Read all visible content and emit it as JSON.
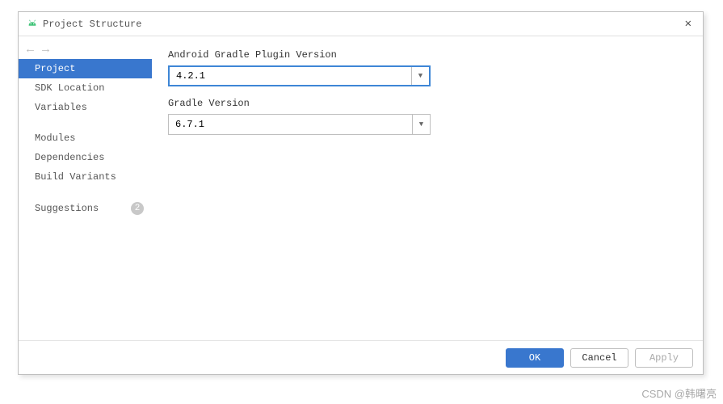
{
  "window": {
    "title": "Project Structure"
  },
  "sidebar": {
    "groups": [
      {
        "items": [
          {
            "label": "Project",
            "selected": true
          },
          {
            "label": "SDK Location"
          },
          {
            "label": "Variables"
          }
        ]
      },
      {
        "items": [
          {
            "label": "Modules"
          },
          {
            "label": "Dependencies"
          },
          {
            "label": "Build Variants"
          }
        ]
      },
      {
        "items": [
          {
            "label": "Suggestions",
            "badge": "2"
          }
        ]
      }
    ]
  },
  "main": {
    "agp": {
      "label": "Android Gradle Plugin Version",
      "value": "4.2.1"
    },
    "gradle": {
      "label": "Gradle Version",
      "value": "6.7.1"
    }
  },
  "buttons": {
    "ok": "OK",
    "cancel": "Cancel",
    "apply": "Apply"
  },
  "watermark": "CSDN @韩曙亮"
}
